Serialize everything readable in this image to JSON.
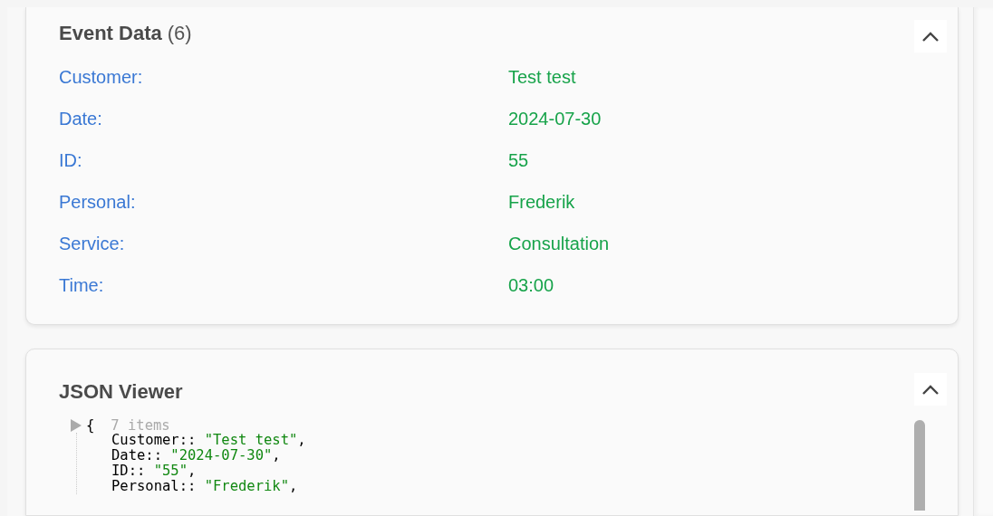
{
  "event_data": {
    "title": "Event Data",
    "count": "(6)",
    "expanded": true,
    "rows": [
      {
        "label": "Customer:",
        "value": "Test test"
      },
      {
        "label": "Date:",
        "value": "2024-07-30"
      },
      {
        "label": "ID:",
        "value": "55"
      },
      {
        "label": "Personal:",
        "value": "Frederik"
      },
      {
        "label": "Service:",
        "value": "Consultation"
      },
      {
        "label": "Time:",
        "value": "03:00"
      }
    ]
  },
  "json_viewer": {
    "title": "JSON Viewer",
    "expanded": true,
    "open_brace": "{",
    "item_count": "7 items",
    "entries": [
      {
        "key": "Customer::",
        "value": "\"Test test\"",
        "comma": ","
      },
      {
        "key": "Date::",
        "value": "\"2024-07-30\"",
        "comma": ","
      },
      {
        "key": "ID::",
        "value": "\"55\"",
        "comma": ","
      },
      {
        "key": "Personal::",
        "value": "\"Frederik\"",
        "comma": ","
      }
    ]
  }
}
